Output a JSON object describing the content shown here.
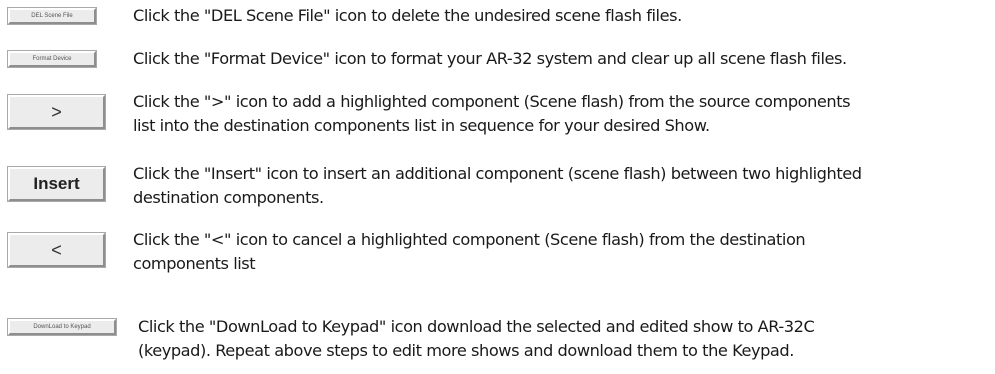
{
  "items": [
    {
      "icon_label": "DEL Scene File",
      "lines": [
        "Click the \"DEL Scene File\" icon to delete the undesired scene flash files."
      ]
    },
    {
      "icon_label": "Format Device",
      "lines": [
        "Click the \"Format Device\" icon to format your AR-32 system and clear up all scene flash files."
      ]
    },
    {
      "icon_label": ">",
      "lines": [
        "Click the \">\" icon to add a highlighted component (Scene flash) from the source components",
        "list into the destination components list in sequence for your desired Show."
      ]
    },
    {
      "icon_label": "Insert",
      "lines": [
        "Click the \"Insert\" icon to insert an additional component (scene flash) between two highlighted",
        "destination components."
      ]
    },
    {
      "icon_label": "<",
      "lines": [
        "Click the \"<\" icon to cancel a highlighted component (Scene flash) from the destination",
        "components list"
      ]
    },
    {
      "icon_label": "DownLoad to Keypad",
      "lines": [
        "Click the \"DownLoad to Keypad\" icon download the selected and edited show to AR-32C",
        "(keypad). Repeat above steps to edit more shows and download them to the Keypad."
      ]
    }
  ]
}
